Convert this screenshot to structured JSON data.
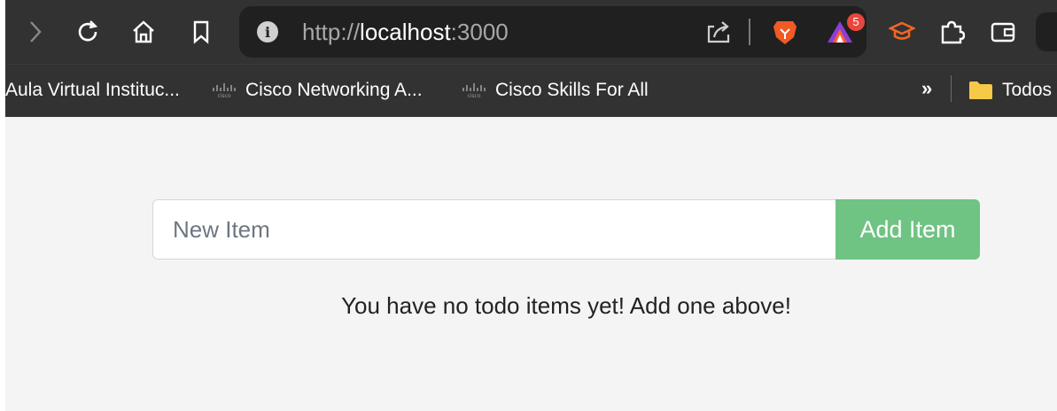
{
  "browser": {
    "url_scheme": "http://",
    "url_host": "localhost",
    "url_port": ":3000",
    "extension_badge_count": "5",
    "bookmarks": [
      {
        "label": "Aula Virtual Instituc...",
        "icon": ""
      },
      {
        "label": "Cisco Networking A...",
        "icon": "cisco-icon"
      },
      {
        "label": "Cisco Skills For All",
        "icon": "cisco-icon"
      }
    ],
    "bookmarks_overflow": "»",
    "folder_label": "Todos"
  },
  "app": {
    "input_placeholder": "New Item",
    "input_value": "",
    "add_button_label": "Add Item",
    "empty_message": "You have no todo items yet! Add one above!"
  },
  "colors": {
    "toolbar_bg": "#323232",
    "page_bg": "#f4f4f4",
    "add_button_bg": "#6fc383"
  }
}
